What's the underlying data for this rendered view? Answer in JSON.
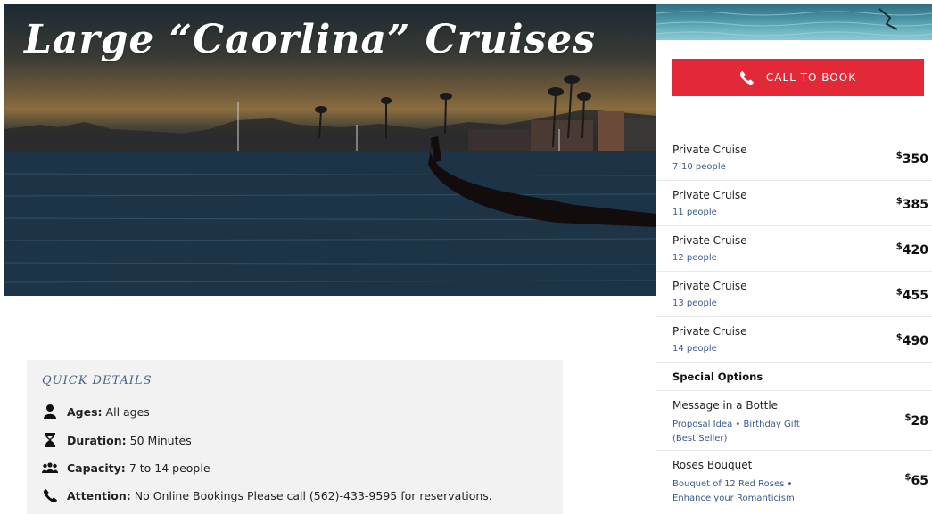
{
  "hero": {
    "title": "Large “Caorlina” Cruises"
  },
  "quick_details": {
    "heading": "QUICK DETAILS",
    "items": [
      {
        "icon": "person-icon",
        "label": "Ages:",
        "value": "All ages"
      },
      {
        "icon": "hourglass-icon",
        "label": "Duration:",
        "value": "50 Minutes"
      },
      {
        "icon": "group-icon",
        "label": "Capacity:",
        "value": "7 to 14 people"
      },
      {
        "icon": "phone-icon",
        "label": "Attention:",
        "value": "No Online Bookings Please call (562)-433-9595 for reservations."
      }
    ]
  },
  "booking": {
    "button_label": "CALL TO BOOK",
    "button_color": "#e32838"
  },
  "pricing": {
    "currency": "$",
    "rows": [
      {
        "name": "Private Cruise",
        "sub": "7-10 people",
        "price": "350"
      },
      {
        "name": "Private Cruise",
        "sub": "11 people",
        "price": "385"
      },
      {
        "name": "Private Cruise",
        "sub": "12 people",
        "price": "420"
      },
      {
        "name": "Private Cruise",
        "sub": "13 people",
        "price": "455"
      },
      {
        "name": "Private Cruise",
        "sub": "14 people",
        "price": "490"
      }
    ],
    "special_heading": "Special Options",
    "options": [
      {
        "name": "Message in a Bottle",
        "sub": "Proposal Idea • Birthday Gift (Best Seller)",
        "price": "28"
      },
      {
        "name": "Roses Bouquet",
        "sub": "Bouquet of 12 Red Roses • Enhance your Romanticism",
        "price": "65"
      }
    ]
  }
}
